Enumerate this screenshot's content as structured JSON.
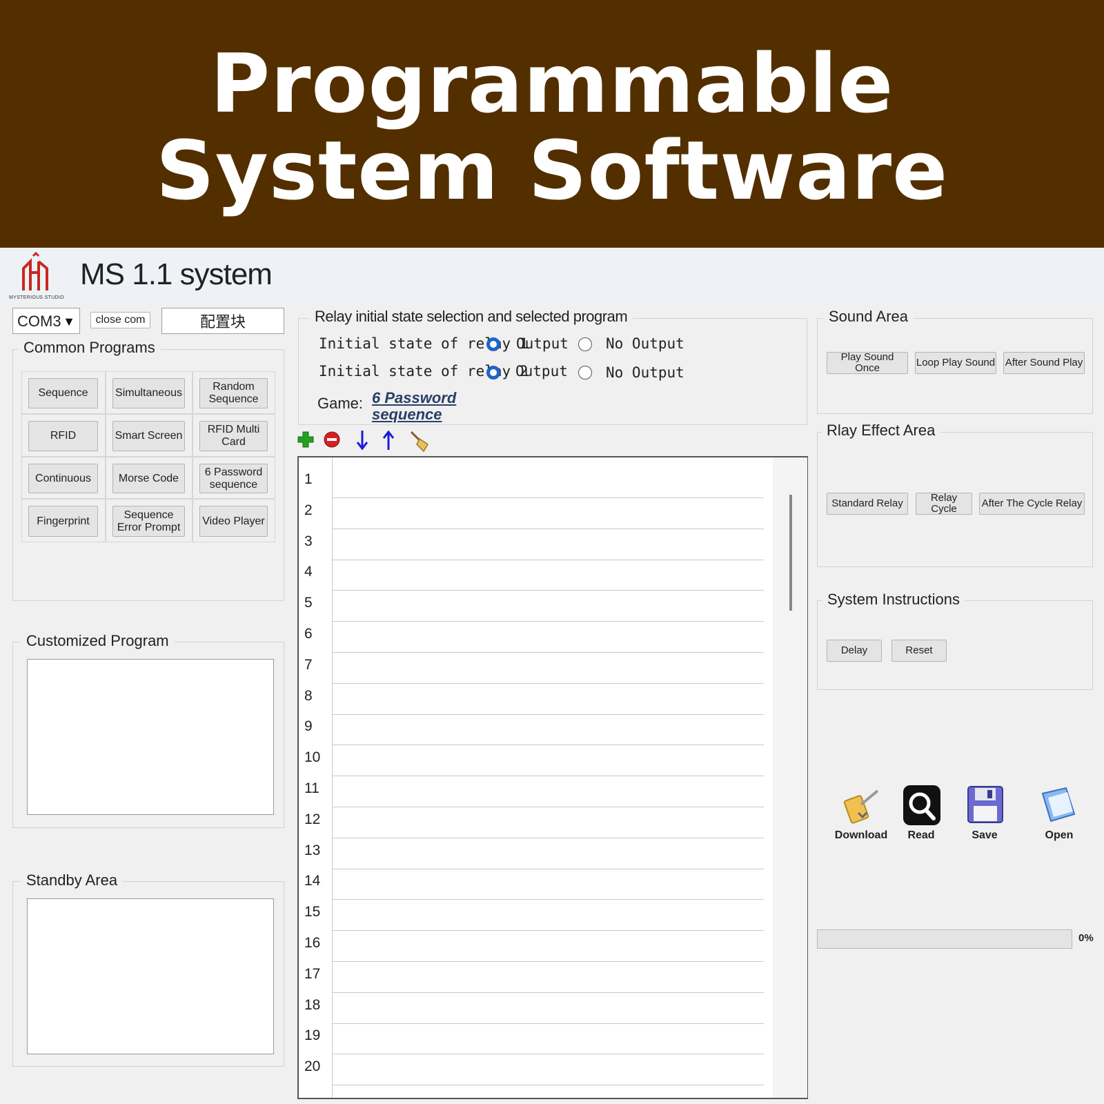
{
  "banner": {
    "line1": "Programmable",
    "line2": "System Software"
  },
  "app": {
    "title": "MS 1.1 system",
    "logo_text": "MYSTERIOUS STUDIO"
  },
  "toolbar": {
    "port": "COM3",
    "close_com": "close com",
    "config_block": "配置块"
  },
  "common_programs": {
    "title": "Common Programs",
    "buttons": [
      [
        "Sequence",
        "Simultaneous",
        "Random Sequence"
      ],
      [
        "RFID",
        "Smart Screen",
        "RFID Multi Card"
      ],
      [
        "Continuous",
        "Morse Code",
        "6 Password sequence"
      ],
      [
        "Fingerprint",
        "Sequence Error Prompt",
        "Video Player"
      ]
    ]
  },
  "customized_program": {
    "title": "Customized Program"
  },
  "standby_area": {
    "title": "Standby Area"
  },
  "relay_panel": {
    "title": "Relay initial state selection and selected program",
    "relay1_label": "Initial state of relay 1",
    "relay2_label": "Initial state of relay 2",
    "output_label": "Output",
    "no_output_label": "No Output",
    "game_label": "Game:",
    "game_line1": "6 Password",
    "game_line2": "sequence"
  },
  "icons": {
    "add": "add-icon",
    "remove": "remove-icon",
    "down": "arrow-down-icon",
    "up": "arrow-up-icon",
    "clear": "broom-icon"
  },
  "rows": [
    "1",
    "2",
    "3",
    "4",
    "5",
    "6",
    "7",
    "8",
    "9",
    "10",
    "11",
    "12",
    "13",
    "14",
    "15",
    "16",
    "17",
    "18",
    "19",
    "20"
  ],
  "sound_area": {
    "title": "Sound Area",
    "buttons": [
      "Play Sound Once",
      "Loop Play Sound",
      "After Sound Play"
    ]
  },
  "relay_effect_area": {
    "title": "Rlay Effect Area",
    "buttons": [
      "Standard Relay",
      "Relay Cycle",
      "After The Cycle Relay"
    ]
  },
  "system_instructions": {
    "title": "System Instructions",
    "buttons": [
      "Delay",
      "Reset"
    ]
  },
  "actions": {
    "download": "Download",
    "read": "Read",
    "save": "Save",
    "open": "Open"
  },
  "progress": {
    "value": 0,
    "label": "0%"
  },
  "colors": {
    "banner": "#532f00",
    "radio_selected": "#1f64c8",
    "add": "#22a022",
    "remove": "#d42020",
    "arrow": "#1a1ad8"
  }
}
